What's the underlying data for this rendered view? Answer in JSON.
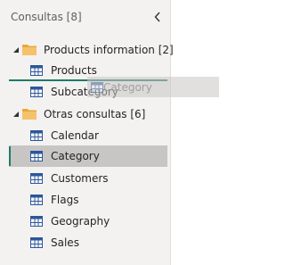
{
  "panel": {
    "title": "Consultas [8]"
  },
  "groups": [
    {
      "name": "Products information [2]",
      "items": [
        "Products",
        "Subcategory"
      ]
    },
    {
      "name": "Otras consultas [6]",
      "items": [
        "Calendar",
        "Category",
        "Customers",
        "Flags",
        "Geography",
        "Sales"
      ]
    }
  ],
  "selected_item": "Category",
  "drag_ghost": {
    "label": "Category"
  },
  "colors": {
    "panel_bg": "#f3f2f1",
    "selected_bg": "#c8c6c4",
    "accent": "#1f7a6a",
    "folder": "#f5c26b",
    "table_icon": "#2b579a"
  },
  "icons": {
    "collapse": "chevron-left-icon",
    "group_expanded": "triangle-down-icon",
    "folder": "folder-icon",
    "query": "table-icon"
  }
}
